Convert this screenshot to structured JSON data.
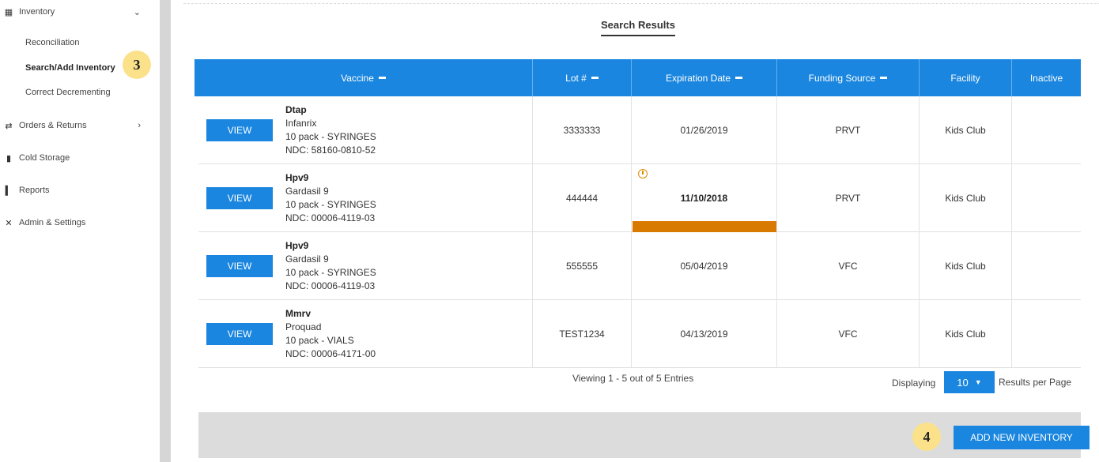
{
  "sidebar": {
    "items": [
      {
        "label": "Inventory",
        "icon": "inventory-icon"
      },
      {
        "label": "Orders & Returns",
        "icon": "transfer-icon"
      },
      {
        "label": "Cold Storage",
        "icon": "thermometer-icon"
      },
      {
        "label": "Reports",
        "icon": "bar-chart-icon"
      },
      {
        "label": "Admin & Settings",
        "icon": "tools-icon"
      }
    ],
    "subitems": [
      "Reconciliation",
      "Search/Add Inventory",
      "Correct Decrementing"
    ],
    "badge": "3"
  },
  "main": {
    "title": "Search Results",
    "columns": [
      "Vaccine",
      "Lot #",
      "Expiration Date",
      "Funding Source",
      "Facility",
      "Inactive"
    ],
    "view_label": "VIEW",
    "rows": [
      {
        "name": "Dtap",
        "brand": "Infanrix",
        "pack": "10 pack - SYRINGES",
        "ndc": "NDC: 58160-0810-52",
        "lot": "3333333",
        "exp": "01/26/2019",
        "funding": "PRVT",
        "facility": "Kids Club",
        "inactive": ""
      },
      {
        "name": "Hpv9",
        "brand": "Gardasil 9",
        "pack": "10 pack - SYRINGES",
        "ndc": "NDC: 00006-4119-03",
        "lot": "444444",
        "exp": "11/10/2018",
        "funding": "PRVT",
        "facility": "Kids Club",
        "inactive": "",
        "expiring": true
      },
      {
        "name": "Hpv9",
        "brand": "Gardasil 9",
        "pack": "10 pack - SYRINGES",
        "ndc": "NDC: 00006-4119-03",
        "lot": "555555",
        "exp": "05/04/2019",
        "funding": "VFC",
        "facility": "Kids Club",
        "inactive": ""
      },
      {
        "name": "Mmrv",
        "brand": "Proquad",
        "pack": "10 pack - VIALS",
        "ndc": "NDC: 00006-4171-00",
        "lot": "TEST1234",
        "exp": "04/13/2019",
        "funding": "VFC",
        "facility": "Kids Club",
        "inactive": ""
      }
    ],
    "viewing_text": "Viewing 1 - 5 out of 5 Entries",
    "displaying_label": "Displaying",
    "page_size": "10",
    "results_per_page_label": "Results per Page",
    "add_button_label": "ADD NEW INVENTORY",
    "badge": "4"
  },
  "colors": {
    "primary": "#1a86df",
    "warning": "#d97a00",
    "badge": "#fbe28a"
  }
}
